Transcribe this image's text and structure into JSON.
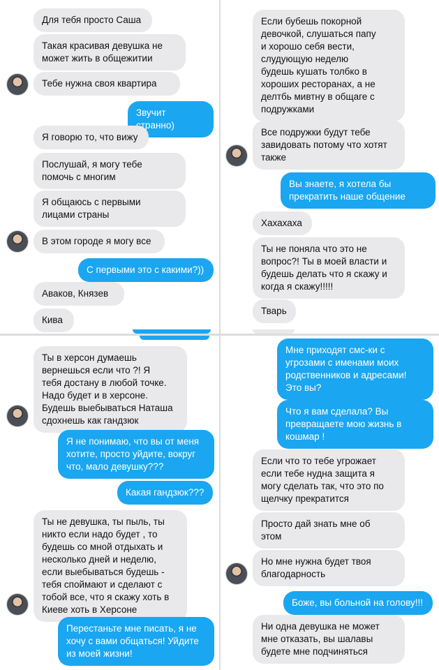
{
  "colors": {
    "incoming_bubble": "#e9e9eb",
    "outgoing_bubble": "#1aa6f0",
    "incoming_text": "#111111",
    "outgoing_text": "#ffffff"
  },
  "icons": {
    "avatar": "user-avatar-photo"
  },
  "panels": {
    "top_left": {
      "messages": [
        {
          "dir": "in",
          "text": "Для тебя просто Саша"
        },
        {
          "dir": "in",
          "text": "Такая красивая девушка не\nможет жить в общежитии"
        },
        {
          "dir": "in",
          "text": "Тебе нужна своя квартира"
        },
        {
          "dir": "out",
          "text": "Звучит странно)"
        },
        {
          "dir": "in",
          "text": "Я говорю то, что вижу"
        },
        {
          "dir": "in",
          "text": "Послушай, я могу тебе\nпомочь с многим"
        },
        {
          "dir": "in",
          "text": "Я общаюсь с первыми\nлицами страны"
        },
        {
          "dir": "in",
          "text": "В этом городе я могу все"
        },
        {
          "dir": "out",
          "text": "С первыми это с какими?))"
        },
        {
          "dir": "in",
          "text": "Аваков, Князев"
        },
        {
          "dir": "in",
          "text": "Кива"
        }
      ]
    },
    "top_right": {
      "messages": [
        {
          "dir": "in",
          "text": "Если бубешь покорной\nдевочкой, слушаться папу\nи хорошо себя вести,\nслудующую неделю\nбудешь кушать толбко в\nхороших ресторанах, а не\nделтбь мивтну в общаге с\nподружками"
        },
        {
          "dir": "in",
          "text": "Все подружки будут тебе\nзавидовать потому что хотят\nтакже"
        },
        {
          "dir": "out",
          "text": "Вы знаете, я хотела бы\nпрекратить наше общение"
        },
        {
          "dir": "in",
          "text": "Хахахаха"
        },
        {
          "dir": "in",
          "text": "Ты не поняла что это не\nвопрос?! Ты в моей власти и\nбудешь делать что я скажу и\nкогда я скажу!!!!!"
        },
        {
          "dir": "in",
          "text": "Тварь"
        }
      ]
    },
    "bottom_left": {
      "messages": [
        {
          "dir": "in",
          "text": "Ты в херсон думаешь\nвернешься если что ?! Я\nтебя достану в любой точке.\nНадо будет и в херсоне.\nБудешь выебываться Наташа\nсдохнешь как гандзюк"
        },
        {
          "dir": "out",
          "text": "Я не понимаю, что вы от меня\nхотите, просто уйдите, вокруг\nчто, мало девушку???"
        },
        {
          "dir": "out",
          "text": "Какая гандзюк???"
        },
        {
          "dir": "in",
          "text": "Ты не девушка, ты пыль, ты\nникто если надо будет , то\nбудешь со мной отдыхать и\nнесколько дней и неделю,\nесли выебываться будешь -\nтебя споймают и сделают с\nтобой все, что я скажу хоть в\nКиеве хоть в Херсоне"
        },
        {
          "dir": "out",
          "text": "Перестаньте мне писать, я не\nхочу с вами общаться! Уйдите\nиз моей жизни!"
        }
      ]
    },
    "bottom_right": {
      "messages": [
        {
          "dir": "out",
          "text": "Мне приходят смс-ки с\nугрозами с именами моих\nродственников и адресами!\nЭто вы?"
        },
        {
          "dir": "out",
          "text": "Что я вам сделала? Вы\nпревращаете мою жизнь в\nкошмар !"
        },
        {
          "dir": "in",
          "text": "Если что то тебе угрожает\nесли тебе нудна защита я\nмогу сделать так, что это по\nщелчку прекратится"
        },
        {
          "dir": "in",
          "text": "Просто дай знать мне об\nэтом"
        },
        {
          "dir": "in",
          "text": "Но мне нужна будет твоя\nблагодарность"
        },
        {
          "dir": "out",
          "text": "Боже, вы больной на голову!!!"
        },
        {
          "dir": "in",
          "text": "Ни одна девушка не может\nмне отказать, вы шалавы\nбудете мне подчиняться"
        }
      ]
    }
  }
}
